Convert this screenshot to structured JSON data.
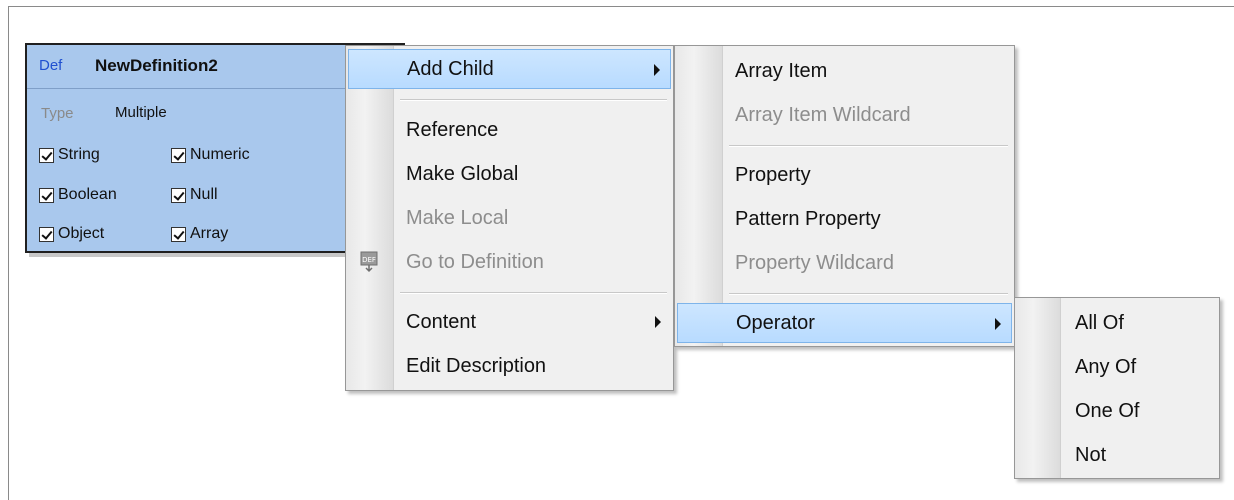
{
  "definition_box": {
    "keyword": "Def",
    "name": "NewDefinition2",
    "type_label": "Type",
    "type_value": "Multiple",
    "types": [
      {
        "label": "String",
        "checked": true
      },
      {
        "label": "Numeric",
        "checked": true
      },
      {
        "label": "Boolean",
        "checked": true
      },
      {
        "label": "Null",
        "checked": true
      },
      {
        "label": "Object",
        "checked": true
      },
      {
        "label": "Array",
        "checked": true
      }
    ]
  },
  "context_menu": {
    "items": [
      {
        "label": "Add Child",
        "submenu": true,
        "highlighted": true
      },
      {
        "label": "Reference"
      },
      {
        "label": "Make Global"
      },
      {
        "label": "Make Local",
        "disabled": true
      },
      {
        "label": "Go to Definition",
        "disabled": true,
        "icon": "go-to-definition-icon"
      },
      {
        "label": "Content",
        "submenu": true
      },
      {
        "label": "Edit Description"
      }
    ]
  },
  "add_child_menu": {
    "items": [
      {
        "label": "Array Item"
      },
      {
        "label": "Array Item Wildcard",
        "disabled": true
      },
      {
        "label": "Property"
      },
      {
        "label": "Pattern Property"
      },
      {
        "label": "Property Wildcard",
        "disabled": true
      },
      {
        "label": "Operator",
        "submenu": true,
        "highlighted": true
      }
    ]
  },
  "operator_menu": {
    "items": [
      {
        "label": "All Of"
      },
      {
        "label": "Any Of"
      },
      {
        "label": "One Of"
      },
      {
        "label": "Not"
      }
    ]
  },
  "colors": {
    "definition_bg": "#a9c8ed",
    "keyword": "#2050d0",
    "highlight": "#cde6ff",
    "disabled_text": "#8d8d8d"
  }
}
